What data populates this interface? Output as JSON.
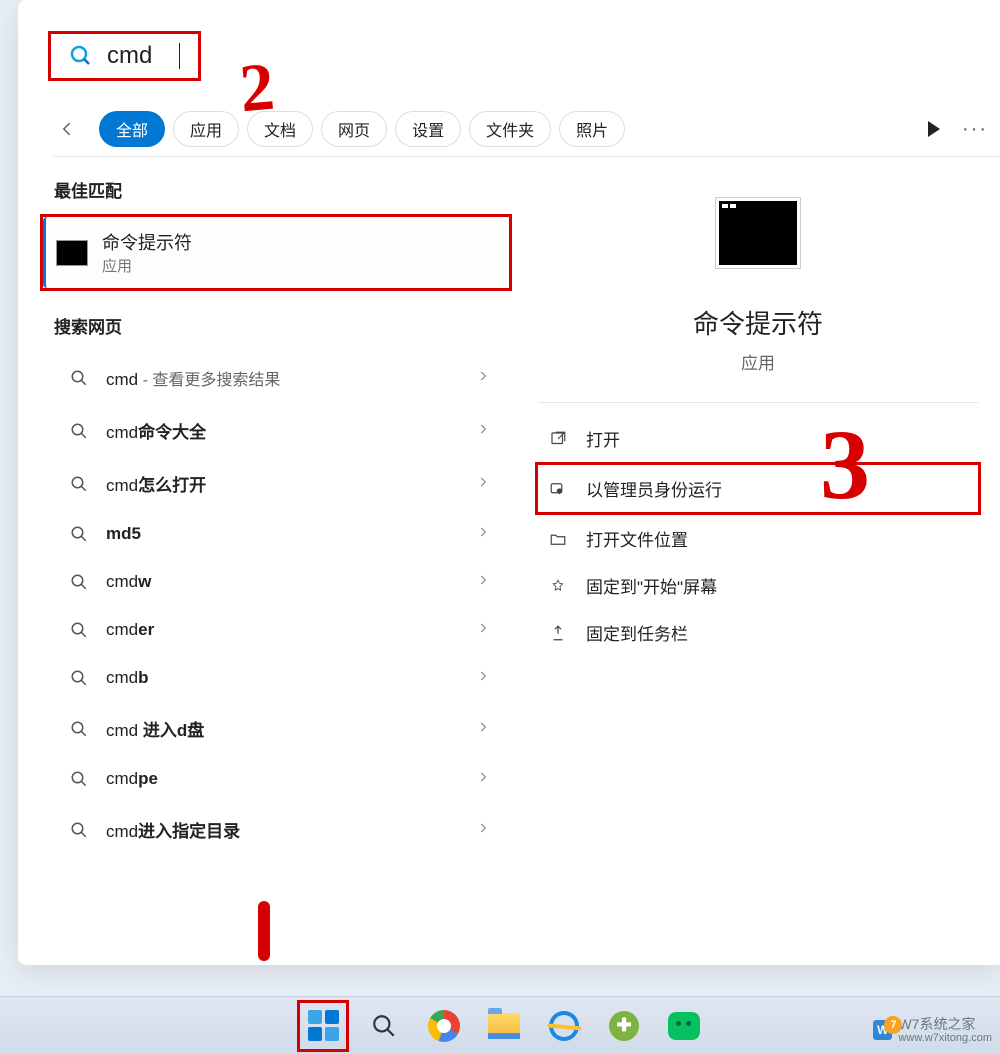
{
  "search": {
    "value": "cmd"
  },
  "filters": {
    "all": "全部",
    "apps": "应用",
    "docs": "文档",
    "web": "网页",
    "settings": "设置",
    "folders": "文件夹",
    "photos": "照片"
  },
  "left": {
    "best_match_header": "最佳匹配",
    "best_match": {
      "title": "命令提示符",
      "subtitle": "应用"
    },
    "web_header": "搜索网页",
    "web_items": [
      {
        "prefix": "cmd",
        "bold": "",
        "suffix": " - 查看更多搜索结果",
        "suffix_faint": true
      },
      {
        "prefix": "cmd",
        "bold": "命令大全",
        "suffix": ""
      },
      {
        "prefix": "cmd",
        "bold": "怎么打开",
        "suffix": ""
      },
      {
        "prefix": "",
        "bold": "md5",
        "suffix": ""
      },
      {
        "prefix": "cmd",
        "bold": "w",
        "suffix": ""
      },
      {
        "prefix": "cmd",
        "bold": "er",
        "suffix": ""
      },
      {
        "prefix": "cmd",
        "bold": "b",
        "suffix": ""
      },
      {
        "prefix": "cmd ",
        "bold": "进入d盘",
        "suffix": ""
      },
      {
        "prefix": "cmd",
        "bold": "pe",
        "suffix": ""
      },
      {
        "prefix": "cmd",
        "bold": "进入指定目录",
        "suffix": ""
      }
    ]
  },
  "detail": {
    "title": "命令提示符",
    "subtitle": "应用",
    "actions": {
      "open": "打开",
      "run_admin": "以管理员身份运行",
      "open_location": "打开文件位置",
      "pin_start": "固定到\"开始\"屏幕",
      "pin_taskbar": "固定到任务栏"
    }
  },
  "watermark": {
    "badge": "W",
    "seven": "7",
    "text_top": "W7系统之家",
    "text_bottom": "www.w7xitong.com"
  },
  "annotations": {
    "one": "1",
    "two": "2",
    "three": "3"
  }
}
